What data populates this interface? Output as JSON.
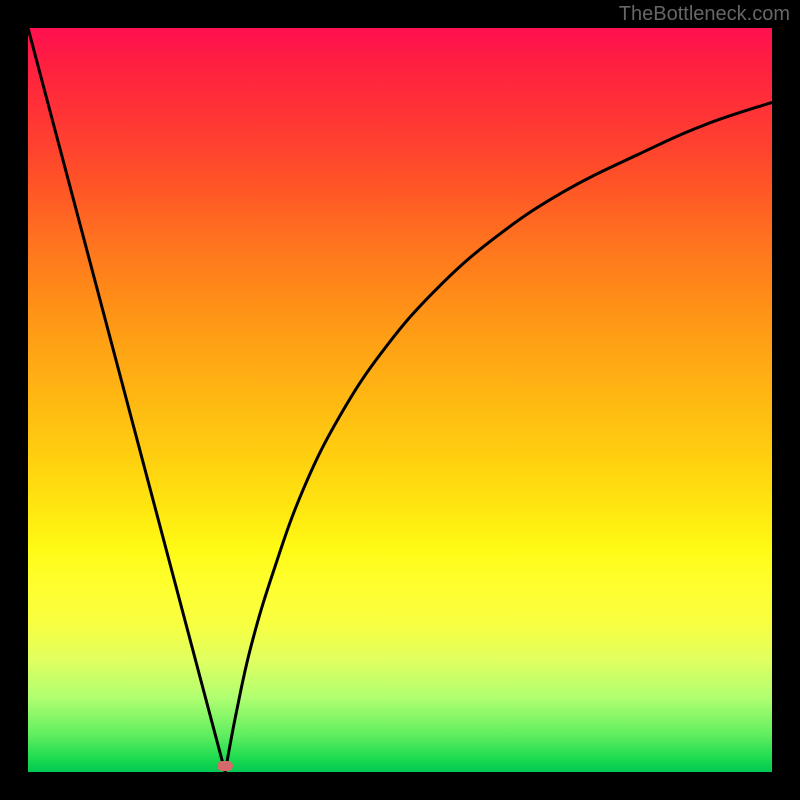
{
  "watermark": "TheBottleneck.com",
  "chart_data": {
    "type": "line",
    "title": "",
    "xlabel": "",
    "ylabel": "",
    "xlim": [
      0,
      100
    ],
    "ylim": [
      0,
      100
    ],
    "series": [
      {
        "name": "left_line",
        "x": [
          0,
          26.5
        ],
        "y": [
          100,
          0
        ]
      },
      {
        "name": "right_curve",
        "x": [
          26.5,
          28,
          30,
          33,
          37,
          42,
          48,
          55,
          63,
          72,
          82,
          91,
          100
        ],
        "y": [
          0,
          8,
          17,
          27,
          38,
          48,
          57,
          65,
          72,
          78,
          83,
          87,
          90
        ]
      }
    ],
    "marker": {
      "x": 26.5,
      "y": 0.8,
      "color": "#d46a6a"
    },
    "background": {
      "type": "gradient",
      "stops": [
        {
          "pos": 0,
          "color": "#ff1050"
        },
        {
          "pos": 50,
          "color": "#ffb812"
        },
        {
          "pos": 75,
          "color": "#ffff30"
        },
        {
          "pos": 100,
          "color": "#00c850"
        }
      ]
    }
  }
}
